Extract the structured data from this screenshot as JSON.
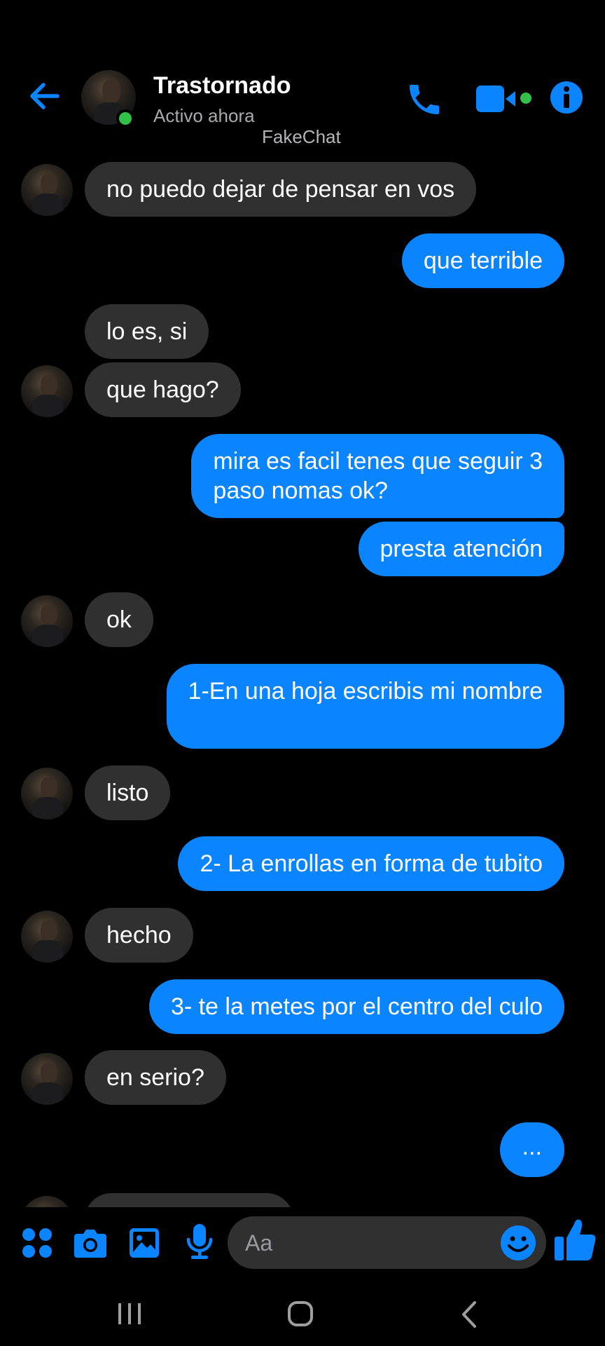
{
  "header": {
    "contact_name": "Trastornado",
    "status": "Activo ahora",
    "watermark": "FakeChat",
    "accent_color": "#0a84ff",
    "online_color": "#31c04a"
  },
  "messages": [
    {
      "side": "in",
      "text": "no puedo dejar de pensar en vos"
    },
    {
      "side": "out",
      "text": "que terrible"
    },
    {
      "side": "in",
      "text": "lo es, si"
    },
    {
      "side": "in",
      "text": "que hago?"
    },
    {
      "side": "out",
      "text": "mira es facil tenes que seguir 3\npaso nomas ok?"
    },
    {
      "side": "out",
      "text": "presta atención"
    },
    {
      "side": "in",
      "text": "ok"
    },
    {
      "side": "out",
      "text": "1-En una hoja escribis mi nombre"
    },
    {
      "side": "in",
      "text": "listo"
    },
    {
      "side": "out",
      "text": "2- La enrollas en forma de tubito"
    },
    {
      "side": "in",
      "text": "hecho"
    },
    {
      "side": "out",
      "text": "3- te la metes por el centro del culo"
    },
    {
      "side": "in",
      "text": "en serio?"
    },
    {
      "side": "out",
      "text": "..."
    }
  ],
  "composer": {
    "placeholder": "Aa",
    "icons": [
      "apps-icon",
      "camera-icon",
      "gallery-icon",
      "microphone-icon",
      "emoji-icon",
      "like-icon"
    ]
  },
  "navbar": {
    "icons": [
      "recent-apps-icon",
      "home-icon",
      "back-nav-icon"
    ]
  }
}
